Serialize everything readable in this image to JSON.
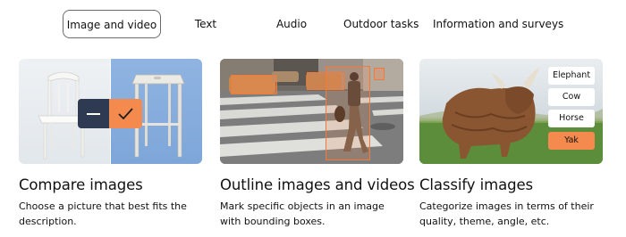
{
  "tabs": [
    {
      "label": "Image and video",
      "active": true
    },
    {
      "label": "Text",
      "active": false
    },
    {
      "label": "Audio",
      "active": false
    },
    {
      "label": "Outdoor tasks",
      "active": false
    },
    {
      "label": "Information and surveys",
      "active": false
    }
  ],
  "cards": [
    {
      "title": "Compare images",
      "description": "Choose a picture that best fits the description."
    },
    {
      "title": "Outline images and videos",
      "description": "Mark specific objects in an image with bounding boxes."
    },
    {
      "title": "Classify images",
      "description": "Categorize images in terms of their quality, theme, angle, etc.",
      "labels": [
        "Elephant",
        "Cow",
        "Horse",
        "Yak"
      ],
      "selected_label": "Yak"
    }
  ],
  "colors": {
    "accent": "#f58a4f",
    "dark_button": "#2e3a52",
    "tab_border": "#6b6b6b"
  }
}
